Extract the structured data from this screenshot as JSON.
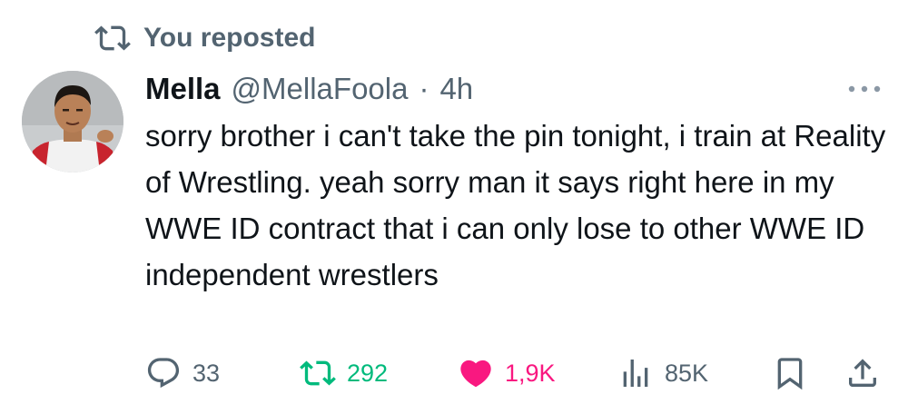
{
  "repost_banner": {
    "label": "You reposted"
  },
  "tweet": {
    "author_name": "Mella",
    "author_handle": "@MellaFoola",
    "separator": "·",
    "time": "4h",
    "text": "sorry brother i can't take the pin tonight, i train at Reality of Wrestling. yeah sorry man it says right here in my WWE ID contract that i can only lose to other WWE ID independent wrestlers"
  },
  "actions": {
    "replies": "33",
    "reposts": "292",
    "likes": "1,9K",
    "views": "85K"
  },
  "colors": {
    "muted": "#536471",
    "repost_active": "#00ba7c",
    "like_active": "#f91880",
    "text": "#0f1419"
  },
  "icons": [
    "repost-icon",
    "more-icon",
    "reply-icon",
    "like-icon",
    "views-icon",
    "bookmark-icon",
    "share-icon"
  ]
}
